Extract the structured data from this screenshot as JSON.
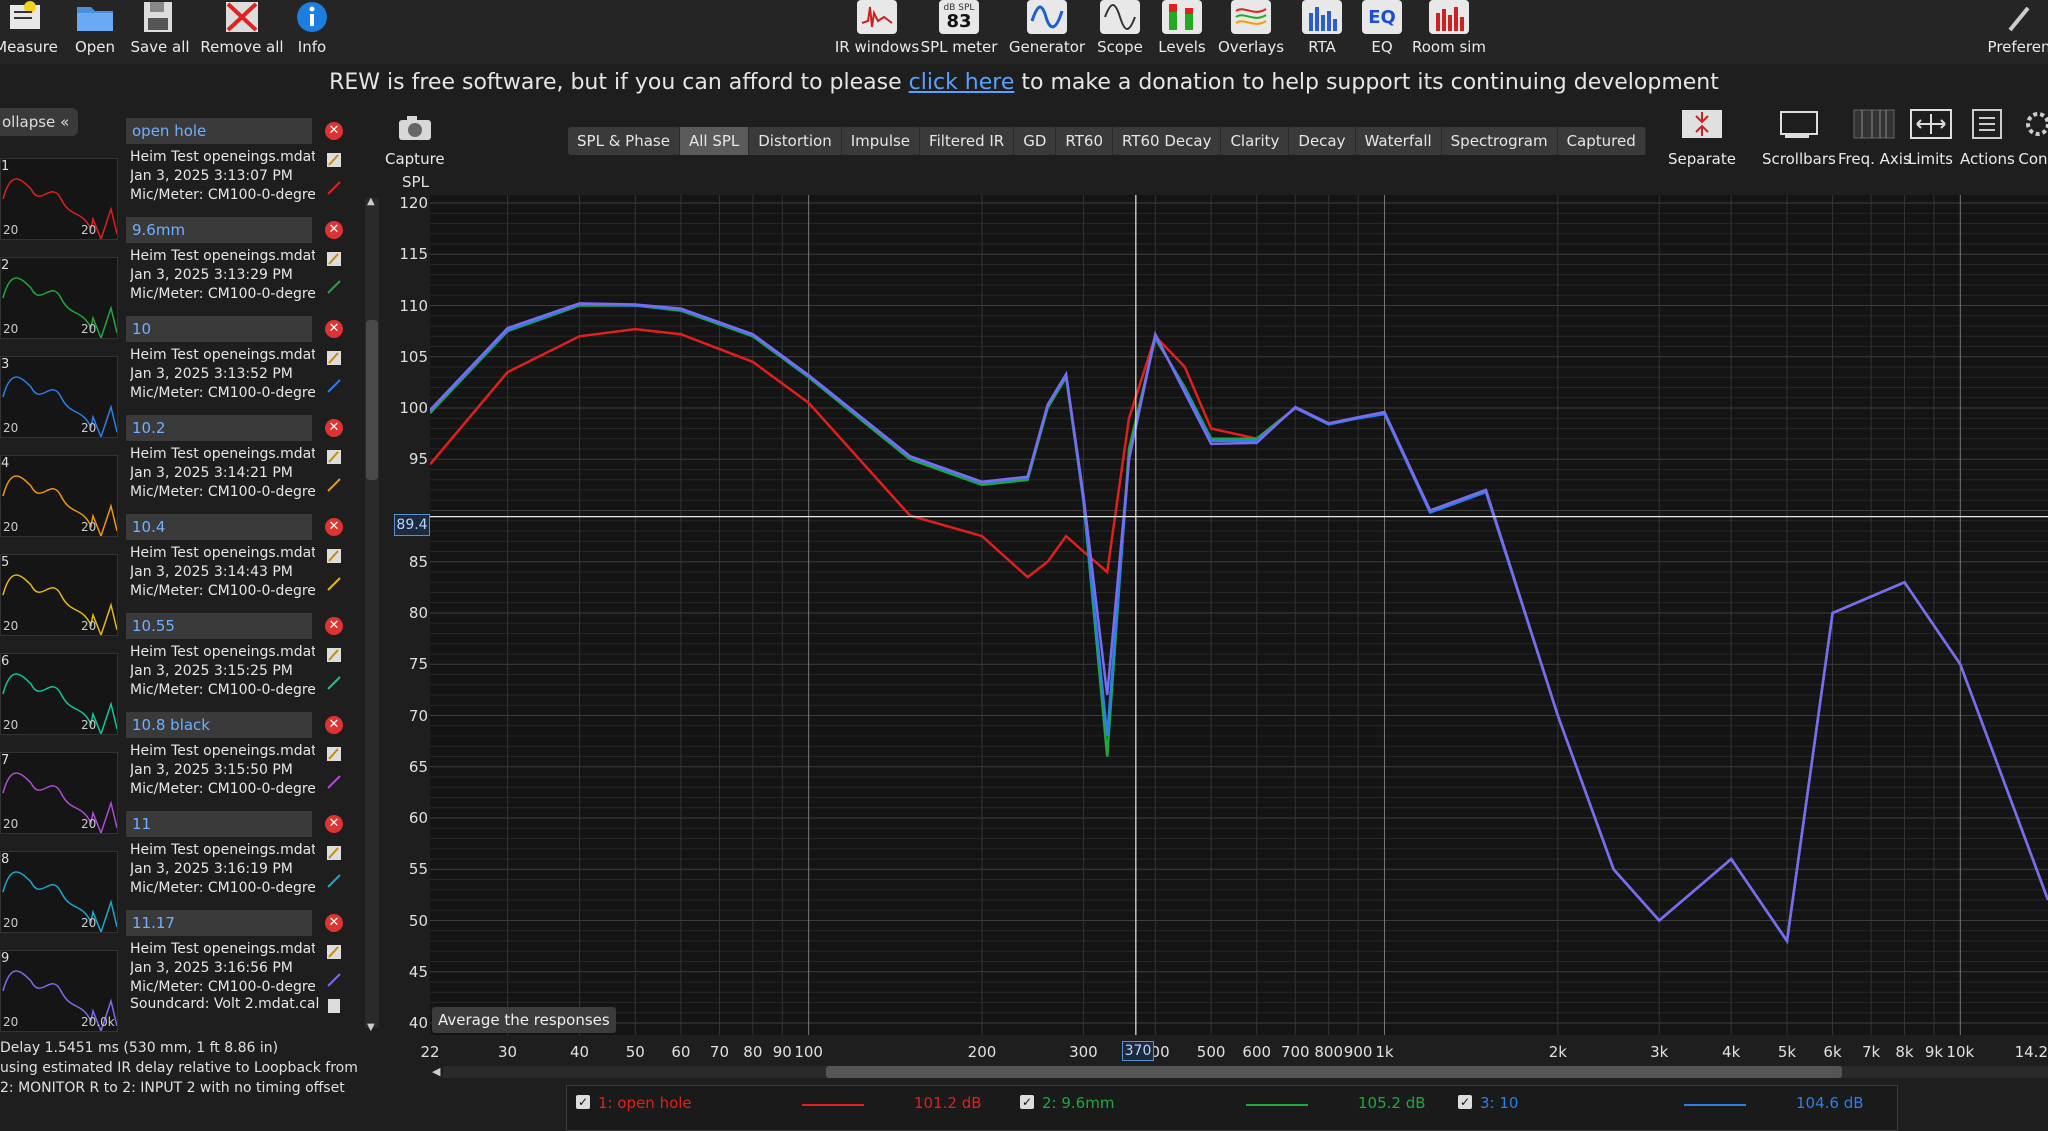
{
  "toolbar": {
    "left": [
      {
        "label": "Measure",
        "icon": "measure-icon"
      },
      {
        "label": "Open",
        "icon": "folder-icon"
      },
      {
        "label": "Save all",
        "icon": "save-icon"
      },
      {
        "label": "Remove all",
        "icon": "remove-icon"
      },
      {
        "label": "Info",
        "icon": "info-icon"
      }
    ],
    "center": [
      {
        "label": "IR windows",
        "icon": "ir-windows-icon"
      },
      {
        "label": "SPL meter",
        "icon": "spl-meter-icon",
        "badge_top": "dB SPL",
        "badge_value": "83"
      },
      {
        "label": "Generator",
        "icon": "generator-icon"
      },
      {
        "label": "Scope",
        "icon": "scope-icon"
      },
      {
        "label": "Levels",
        "icon": "levels-icon"
      },
      {
        "label": "Overlays",
        "icon": "overlays-icon"
      },
      {
        "label": "RTA",
        "icon": "rta-icon"
      },
      {
        "label": "EQ",
        "icon": "eq-icon"
      },
      {
        "label": "Room sim",
        "icon": "room-sim-icon"
      }
    ],
    "right": {
      "label": "Preferen",
      "icon": "preferences-icon"
    }
  },
  "banner": {
    "before": "REW is free software, but if you can afford to please ",
    "link": "click here",
    "after": " to make a donation to help support its continuing development"
  },
  "collapse_label": "ollapse",
  "measurements": [
    {
      "num": "1",
      "name": "open hole",
      "file": "Heim Test openeings.mdat",
      "date": "Jan 3, 2025 3:13:07 PM",
      "mic": "Mic/Meter: CM100-0-degree",
      "color": "#e0201c",
      "ax_left": "20",
      "ax_right": "20"
    },
    {
      "num": "2",
      "name": "9.6mm",
      "file": "Heim Test openeings.mdat",
      "date": "Jan 3, 2025 3:13:29 PM",
      "mic": "Mic/Meter: CM100-0-degree",
      "color": "#1fa83c",
      "ax_left": "20",
      "ax_right": "20"
    },
    {
      "num": "3",
      "name": "10",
      "file": "Heim Test openeings.mdat",
      "date": "Jan 3, 2025 3:13:52 PM",
      "mic": "Mic/Meter: CM100-0-degree",
      "color": "#2a7fe8",
      "ax_left": "20",
      "ax_right": "20"
    },
    {
      "num": "4",
      "name": "10.2",
      "file": "Heim Test openeings.mdat",
      "date": "Jan 3, 2025 3:14:21 PM",
      "mic": "Mic/Meter: CM100-0-degree",
      "color": "#f0960c",
      "ax_left": "20",
      "ax_right": "20"
    },
    {
      "num": "5",
      "name": "10.4",
      "file": "Heim Test openeings.mdat",
      "date": "Jan 3, 2025 3:14:43 PM",
      "mic": "Mic/Meter: CM100-0-degree",
      "color": "#e3b912",
      "ax_left": "20",
      "ax_right": "20"
    },
    {
      "num": "6",
      "name": "10.55",
      "file": "Heim Test openeings.mdat",
      "date": "Jan 3, 2025 3:15:25 PM",
      "mic": "Mic/Meter: CM100-0-degree",
      "color": "#14c49a",
      "ax_left": "20",
      "ax_right": "20"
    },
    {
      "num": "7",
      "name": "10.8 black",
      "file": "Heim Test openeings.mdat",
      "date": "Jan 3, 2025 3:15:50 PM",
      "mic": "Mic/Meter: CM100-0-degree",
      "color": "#b04ad8",
      "ax_left": "20",
      "ax_right": "20"
    },
    {
      "num": "8",
      "name": "11",
      "file": "Heim Test openeings.mdat",
      "date": "Jan 3, 2025 3:16:19 PM",
      "mic": "Mic/Meter: CM100-0-degree",
      "color": "#18a8d0",
      "ax_left": "20",
      "ax_right": "20"
    },
    {
      "num": "9",
      "name": "11.17",
      "file": "Heim Test openeings.mdat",
      "date": "Jan 3, 2025 3:16:56 PM",
      "mic": "Mic/Meter: CM100-0-degree",
      "extra": "Soundcard: Volt 2.mdat.cal",
      "color": "#7a6cf0",
      "ax_left": "20",
      "ax_right": "20.0k"
    }
  ],
  "status": {
    "line1": "Delay 1.5451 ms (530 mm, 1 ft 8.86 in)",
    "line2": "using estimated IR delay relative to Loopback from",
    "line3": "2: MONITOR R to 2: INPUT 2 with no timing offset"
  },
  "capture_label": "Capture",
  "tabs": [
    "SPL & Phase",
    "All SPL",
    "Distortion",
    "Impulse",
    "Filtered IR",
    "GD",
    "RT60",
    "RT60 Decay",
    "Clarity",
    "Decay",
    "Waterfall",
    "Spectrogram",
    "Captured"
  ],
  "active_tab": "All SPL",
  "right_tools": [
    {
      "label": "Separate",
      "icon": "separate-icon"
    },
    {
      "label": "Scrollbars",
      "icon": "scrollbars-icon"
    },
    {
      "label": "Freq. Axis",
      "icon": "freq-axis-icon"
    },
    {
      "label": "Limits",
      "icon": "limits-icon"
    },
    {
      "label": "Actions",
      "icon": "actions-icon"
    },
    {
      "label": "Con",
      "icon": "controls-icon"
    }
  ],
  "avg_button": "Average the responses",
  "cursor": {
    "y": "89.4",
    "x": "370"
  },
  "chart_data": {
    "type": "line",
    "ylabel": "SPL",
    "ylim": [
      40,
      120
    ],
    "xscale": "log",
    "xlim": [
      22,
      14200
    ],
    "y_ticks": [
      120,
      115,
      110,
      105,
      100,
      95,
      90,
      85,
      80,
      75,
      70,
      65,
      60,
      55,
      50,
      45,
      40
    ],
    "y_tick_labels": [
      "120",
      "115",
      "110",
      "105",
      "100",
      "95",
      "",
      "85",
      "80",
      "75",
      "70",
      "65",
      "60",
      "55",
      "50",
      "45",
      "40"
    ],
    "x_ticks": [
      22,
      30,
      40,
      50,
      60,
      70,
      80,
      90,
      100,
      200,
      300,
      400,
      500,
      600,
      700,
      800,
      900,
      1000,
      2000,
      3000,
      4000,
      5000,
      6000,
      7000,
      8000,
      9000,
      10000,
      14200
    ],
    "x_tick_labels": [
      "22",
      "30",
      "40",
      "50",
      "60",
      "70",
      "80",
      "90",
      "100",
      "200",
      "300",
      "400",
      "500",
      "600",
      "700",
      "800",
      "900",
      "1k",
      "2k",
      "3k",
      "4k",
      "5k",
      "6k",
      "7k",
      "8k",
      "9k",
      "10k",
      "14.2"
    ],
    "grid": true,
    "series": [
      {
        "name": "1: open hole",
        "color": "#e0201c",
        "x": [
          22,
          30,
          40,
          50,
          60,
          80,
          100,
          150,
          200,
          240,
          260,
          280,
          300,
          330,
          360,
          400,
          450,
          500,
          600,
          700,
          800,
          900,
          1000,
          1200,
          1500,
          2000,
          2500,
          3000,
          4000,
          5000,
          6000,
          8000,
          10000,
          14200
        ],
        "y": [
          94.5,
          103.5,
          107,
          107.7,
          107.2,
          104.5,
          100.5,
          89.5,
          87.5,
          83.5,
          85,
          87.5,
          86,
          84,
          99,
          107,
          104,
          98,
          97,
          100,
          98.5,
          99,
          99.5,
          90,
          92,
          70,
          55,
          50,
          56,
          48,
          80,
          83,
          75,
          52
        ]
      },
      {
        "name": "2: 9.6mm",
        "color": "#1fa83c",
        "x": [
          22,
          30,
          40,
          50,
          60,
          80,
          100,
          150,
          200,
          240,
          260,
          280,
          300,
          330,
          360,
          400,
          450,
          500,
          600,
          700,
          800,
          900,
          1000,
          1200,
          1500,
          2000,
          2500,
          3000,
          4000,
          5000,
          6000,
          8000,
          10000,
          14200
        ],
        "y": [
          99.5,
          107.5,
          110,
          110,
          109.5,
          107,
          103,
          95,
          92.5,
          93,
          100,
          103,
          91,
          66,
          96,
          106.8,
          102,
          97,
          97,
          100,
          98.5,
          99,
          99.5,
          90,
          92,
          70,
          55,
          50,
          56,
          48,
          80,
          83,
          75,
          52
        ]
      },
      {
        "name": "3: 10",
        "color": "#2a7fe8",
        "x": [
          22,
          30,
          40,
          50,
          60,
          80,
          100,
          150,
          200,
          240,
          260,
          280,
          300,
          330,
          360,
          400,
          450,
          500,
          600,
          700,
          800,
          900,
          1000,
          1200,
          1500,
          2000,
          2500,
          3000,
          4000,
          5000,
          6000,
          8000,
          10000,
          14200
        ],
        "y": [
          99.7,
          107.6,
          110.1,
          110,
          109.6,
          107.1,
          103.1,
          95.2,
          92.7,
          93.2,
          100.2,
          103.2,
          91,
          68,
          95,
          107,
          101.8,
          96.8,
          96.8,
          100,
          98.4,
          99,
          99.4,
          89.8,
          91.8,
          70,
          55,
          50,
          56,
          48,
          80,
          83,
          75,
          52
        ]
      },
      {
        "name": "9: 11.17",
        "color": "#7a6cf0",
        "x": [
          22,
          30,
          40,
          50,
          60,
          80,
          100,
          150,
          200,
          240,
          260,
          280,
          300,
          330,
          360,
          400,
          450,
          500,
          600,
          700,
          800,
          900,
          1000,
          1200,
          1500,
          2000,
          2500,
          3000,
          4000,
          5000,
          6000,
          8000,
          10000,
          14200
        ],
        "y": [
          99.8,
          107.8,
          110.2,
          110.1,
          109.7,
          107.2,
          103.2,
          95.3,
          92.8,
          93.3,
          100.3,
          103.3,
          91.5,
          72,
          95,
          107.2,
          101.5,
          96.5,
          96.6,
          100.1,
          98.5,
          99.1,
          99.6,
          90,
          92,
          70,
          55,
          50,
          56,
          48,
          80,
          83,
          75,
          52
        ]
      }
    ]
  },
  "legend": [
    {
      "label": "1: open hole",
      "value": "101.2 dB",
      "color": "#e0201c"
    },
    {
      "label": "2: 9.6mm",
      "value": "105.2 dB",
      "color": "#1fa83c"
    },
    {
      "label": "3: 10",
      "value": "104.6 dB",
      "color": "#2a7fe8"
    }
  ],
  "chk": "✓"
}
